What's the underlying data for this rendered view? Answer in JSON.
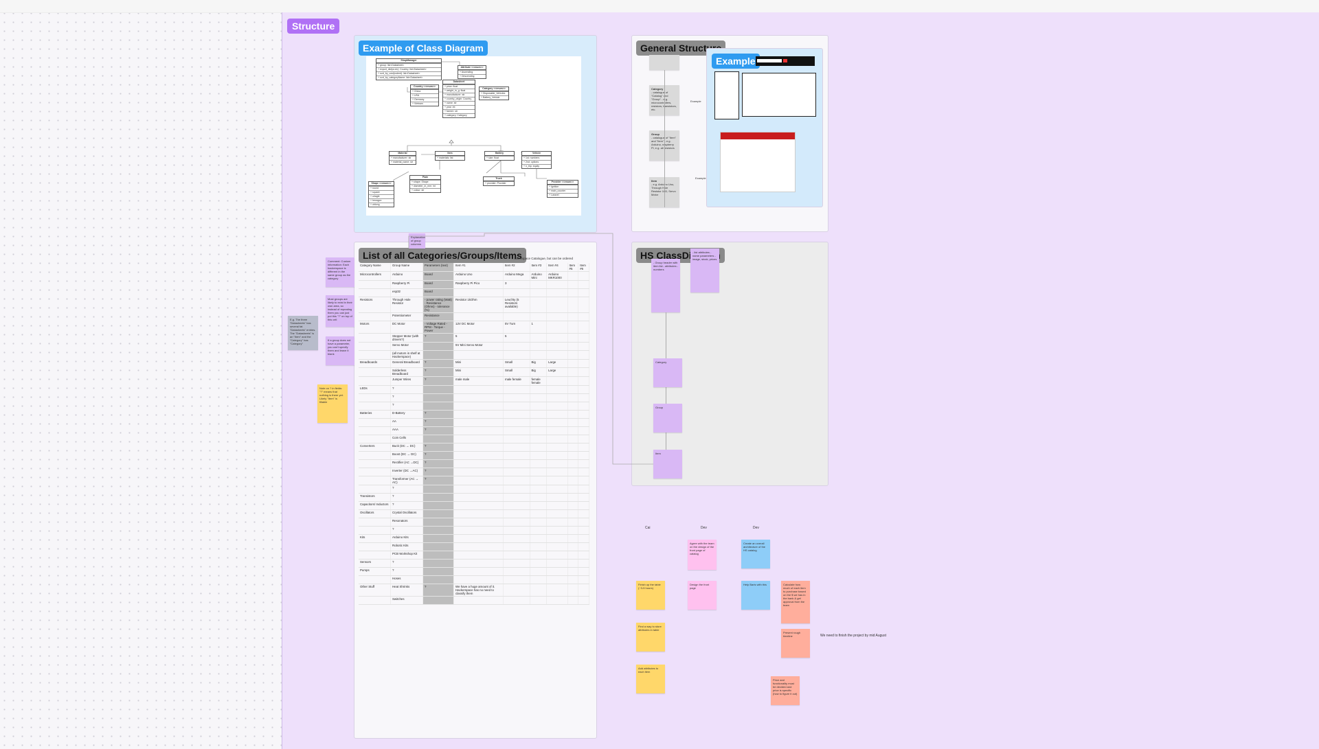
{
  "section": {
    "title": "Structure"
  },
  "frames": {
    "class_diagram": {
      "title": "Example of Class Diagram"
    },
    "general": {
      "title": "General Structure",
      "example_title": "Example"
    },
    "list": {
      "title": "List of all Categories/Groups/Items",
      "note": "...namespace Catalogue, but can be ordered"
    },
    "hs": {
      "title": "HS ClassDiagram"
    }
  },
  "uml": {
    "shop": {
      "name": "ShopManager",
      "rows": [
        "+ group: list<Datasheet>",
        "+ export_dict(a=dv): Country: list<Datasheet>",
        "+ sort_by_cost(rodent): list<Datasheet>",
        "+ sort_by_categoryName: list<Datasheet>"
      ]
    },
    "attr": {
      "name": "Attribute <<enum>>",
      "rows": [
        "+ Ascending",
        "+ Descending"
      ]
    },
    "country": {
      "name": "Country <<enum>>",
      "rows": [
        "+ China",
        "+ USA",
        "+ Germany",
        "+ Vietnam"
      ]
    },
    "datasheet": {
      "name": "Datasheet",
      "rows": [
        "+ price: float",
        "+ weight_in_g: float",
        "+ manufacturer: str",
        "+ country_origin: Country",
        "+ name: str",
        "+ year: int",
        "+ farmer: str",
        "+ category: Category"
      ]
    },
    "category": {
      "name": "Category <<enum>>",
      "rows": [
        "+ Disposable_Vehicles",
        "+ Battery_Vehicle"
      ]
    },
    "material": {
      "name": "Material",
      "rows": [
        "+ manufacturer: str",
        "+ material_name: str"
      ]
    },
    "item": {
      "name": "Item",
      "rows": [
        "+ materials: list"
      ]
    },
    "battery": {
      "name": "Battery",
      "rows": [
        "+ size: float"
      ]
    },
    "vehicle": {
      "name": "Vehicle",
      "rows": [
        "+ 1st: numbers",
        "+ 2nd: options",
        "+ n_trip: equity"
      ]
    },
    "shape": {
      "name": "Shape <<enum>>",
      "rows": [
        "+ round",
        "+ square",
        "+ oriagle",
        "+ hexagon",
        "+ oblong"
      ]
    },
    "plate": {
      "name": "Plate",
      "rows": [
        "+ shape: Shape",
        "+ diameter_in_mm: int",
        "+ colour: str"
      ]
    },
    "truck": {
      "name": "Truck",
      "rows": [
        "+ provider: Provider"
      ]
    },
    "provider": {
      "name": "Provider <<enum>>",
      "rows": [
        "+ Ignition",
        "+ main_counter",
        "+ Laravel"
      ]
    }
  },
  "general_cards": {
    "category": {
      "title": "Category",
      "text": "- catalogue of \"Catalog\" and \"Group\"\n- e.g. microcontrollers, resistors, transistors, etc."
    },
    "group": {
      "title": "Group",
      "text": "- catalogue of \"Item\" and \"Item\"\n- e.g. Arduino, raspberry Pi, e.g. all resistors"
    },
    "item": {
      "title": "Item",
      "text": "- e.g. Arduino Uno, Through Hole Resistor 1kΩ, Servo Motor"
    },
    "labels": [
      "Example",
      "Example for Structure",
      "Example"
    ]
  },
  "table": {
    "headers": [
      "Category Name",
      "Group Name",
      "Parameters (text)",
      "Item #1",
      "Item #2",
      "Item #3",
      "Item #4",
      "Item #5",
      "Item #6"
    ],
    "rows": [
      [
        "Microcontrollers",
        "Arduino",
        "Board",
        "Arduino Uno",
        "Arduino Mega",
        "Arduino Mini",
        "Arduino MKR1000",
        "",
        ""
      ],
      [
        "",
        "Raspberry Pi",
        "Board",
        "Raspberry Pi Pico",
        "3",
        "",
        "",
        "",
        ""
      ],
      [
        "",
        "esp32",
        "Board",
        "",
        "",
        "",
        "",
        "",
        ""
      ],
      [
        "Resistors",
        "Through Hole Resistor",
        "- power rating (Watt)\n- Resistance (Ohms)\n- tolerance (%)",
        "Resistor 1kOhm",
        "Leuchty (5 Resistors available)",
        "",
        "",
        "",
        ""
      ],
      [
        "",
        "Potentiometer",
        "Resistance",
        "",
        "",
        "",
        "",
        "",
        ""
      ],
      [
        "Motors",
        "DC Motor",
        "- Voltage Rated\n- RPM\n- Torque\n- Power",
        "12V DC Motor",
        "5V Turn",
        "1",
        "",
        "",
        ""
      ],
      [
        "",
        "Stepper Motor (with drivers?)",
        "?",
        "5",
        "5",
        "",
        "",
        "",
        ""
      ],
      [
        "",
        "Servo Motor",
        "",
        "5V Mini Servo Motor",
        "",
        "",
        "",
        "",
        ""
      ],
      [
        "",
        "(all motors in shelf at Hackerspace)",
        "",
        "",
        "",
        "",
        "",
        "",
        ""
      ],
      [
        "Breadboards",
        "General Breadboard",
        "?",
        "Mini",
        "Small",
        "Big",
        "Large",
        "",
        ""
      ],
      [
        "",
        "Solderless Breadboard",
        "?",
        "Mini",
        "Small",
        "Big",
        "Large",
        "",
        ""
      ],
      [
        "",
        "Jumper Wires",
        "?",
        "male male",
        "male female",
        "female female",
        "",
        "",
        ""
      ],
      [
        "LEDs",
        "?",
        "",
        "",
        "",
        "",
        "",
        "",
        ""
      ],
      [
        "",
        "?",
        "",
        "",
        "",
        "",
        "",
        "",
        ""
      ],
      [
        "",
        "?",
        "",
        "",
        "",
        "",
        "",
        "",
        ""
      ],
      [
        "Batteries",
        "D-Battery",
        "?",
        "",
        "",
        "",
        "",
        "",
        ""
      ],
      [
        "",
        "AA",
        "?",
        "",
        "",
        "",
        "",
        "",
        ""
      ],
      [
        "",
        "AAA",
        "?",
        "",
        "",
        "",
        "",
        "",
        ""
      ],
      [
        "",
        "Coin Cells",
        "",
        "",
        "",
        "",
        "",
        "",
        ""
      ],
      [
        "Converters",
        "Buck (DC → DC)",
        "?",
        "",
        "",
        "",
        "",
        "",
        ""
      ],
      [
        "",
        "Boost (DC → DC)",
        "?",
        "",
        "",
        "",
        "",
        "",
        ""
      ],
      [
        "",
        "Rectifier (AC →DC)",
        "?",
        "",
        "",
        "",
        "",
        "",
        ""
      ],
      [
        "",
        "Inverter (DC →AC)",
        "?",
        "",
        "",
        "",
        "",
        "",
        ""
      ],
      [
        "",
        "Transformer (AC → AC)",
        "?",
        "",
        "",
        "",
        "",
        "",
        ""
      ],
      [
        "",
        "?",
        "",
        "",
        "",
        "",
        "",
        "",
        ""
      ],
      [
        "Transistors",
        "?",
        "",
        "",
        "",
        "",
        "",
        "",
        ""
      ],
      [
        "Capacitors/ Inductors",
        "?",
        "",
        "",
        "",
        "",
        "",
        "",
        ""
      ],
      [
        "Oscillators",
        "Crystal Oscillators",
        "",
        "",
        "",
        "",
        "",
        "",
        ""
      ],
      [
        "",
        "Resonators",
        "",
        "",
        "",
        "",
        "",
        "",
        ""
      ],
      [
        "",
        "?",
        "",
        "",
        "",
        "",
        "",
        "",
        ""
      ],
      [
        "Kits",
        "Arduino Kits",
        "",
        "",
        "",
        "",
        "",
        "",
        ""
      ],
      [
        "",
        "Robotic Kits",
        "",
        "",
        "",
        "",
        "",
        "",
        ""
      ],
      [
        "",
        "PCB Workshop Kit",
        "",
        "",
        "",
        "",
        "",
        "",
        ""
      ],
      [
        "Sensors",
        "?",
        "",
        "",
        "",
        "",
        "",
        "",
        ""
      ],
      [
        "Pumps",
        "?",
        "",
        "",
        "",
        "",
        "",
        "",
        ""
      ],
      [
        "",
        "Hoses",
        "",
        "",
        "",
        "",
        "",
        "",
        ""
      ],
      [
        "Other Stuff",
        "Heat Shrinks",
        "?",
        "We have a huge amount of it. Hackerspace has no need to classify them",
        "",
        "",
        "",
        "",
        ""
      ],
      [
        "",
        "Switches",
        "",
        "",
        "",
        "",
        "",
        "",
        ""
      ]
    ]
  },
  "side_notes": {
    "purple1": "Comment: Custom information: Each hackerspace is different in the same group as the category",
    "purple2": "Most groups are likely to exist in their own area, so instead of repeating them you can just put this \"?\" on top of this cell",
    "purple3": "If a group does not have a parameter, you can't specify them and leave it blank",
    "gray1": "E.g. The three \"Datasheets\" has several fat \"Datasheets\" entries. The \"Datasheets\" is an \"Item\" and the \"Category\" has \"Category\"",
    "yellow1": "Note on ? in fields: \"?\" means that nothing is there yet. Likely \"Item\" is fillable",
    "pointer": "Explanation of group columns"
  },
  "hs_cards": {
    "top1": "- Group header with item list\n- attributes\n- numbers",
    "top2": "- list attributes\n- name parameters\n- image, stock, prices",
    "category": "Category",
    "group": "Group",
    "item": "Item"
  },
  "board": {
    "columns": [
      "Cai",
      "Dev",
      "Dev"
    ],
    "notes": {
      "yellow1": "Finish up the table (~3-5 hours)",
      "yellow2": "Find a way to store attributes in table",
      "yellow3": "Add attributes to each item",
      "pink1": "Agree with the team on the design of the front page of catalog",
      "pink2": "Design the front page",
      "blue1": "Create an overall architecture of the HS catalog",
      "blue2": "Help Baris with this",
      "salmon1": "Calculate how much of each item to purchase based on the $ we has in the bank & get approval from the team",
      "salmon2": "Present rough timeline",
      "salmon3": "Price and functionality must be decided and price is specific (how to figure it out)"
    },
    "deadline": "We need to finish the project by mid August"
  }
}
